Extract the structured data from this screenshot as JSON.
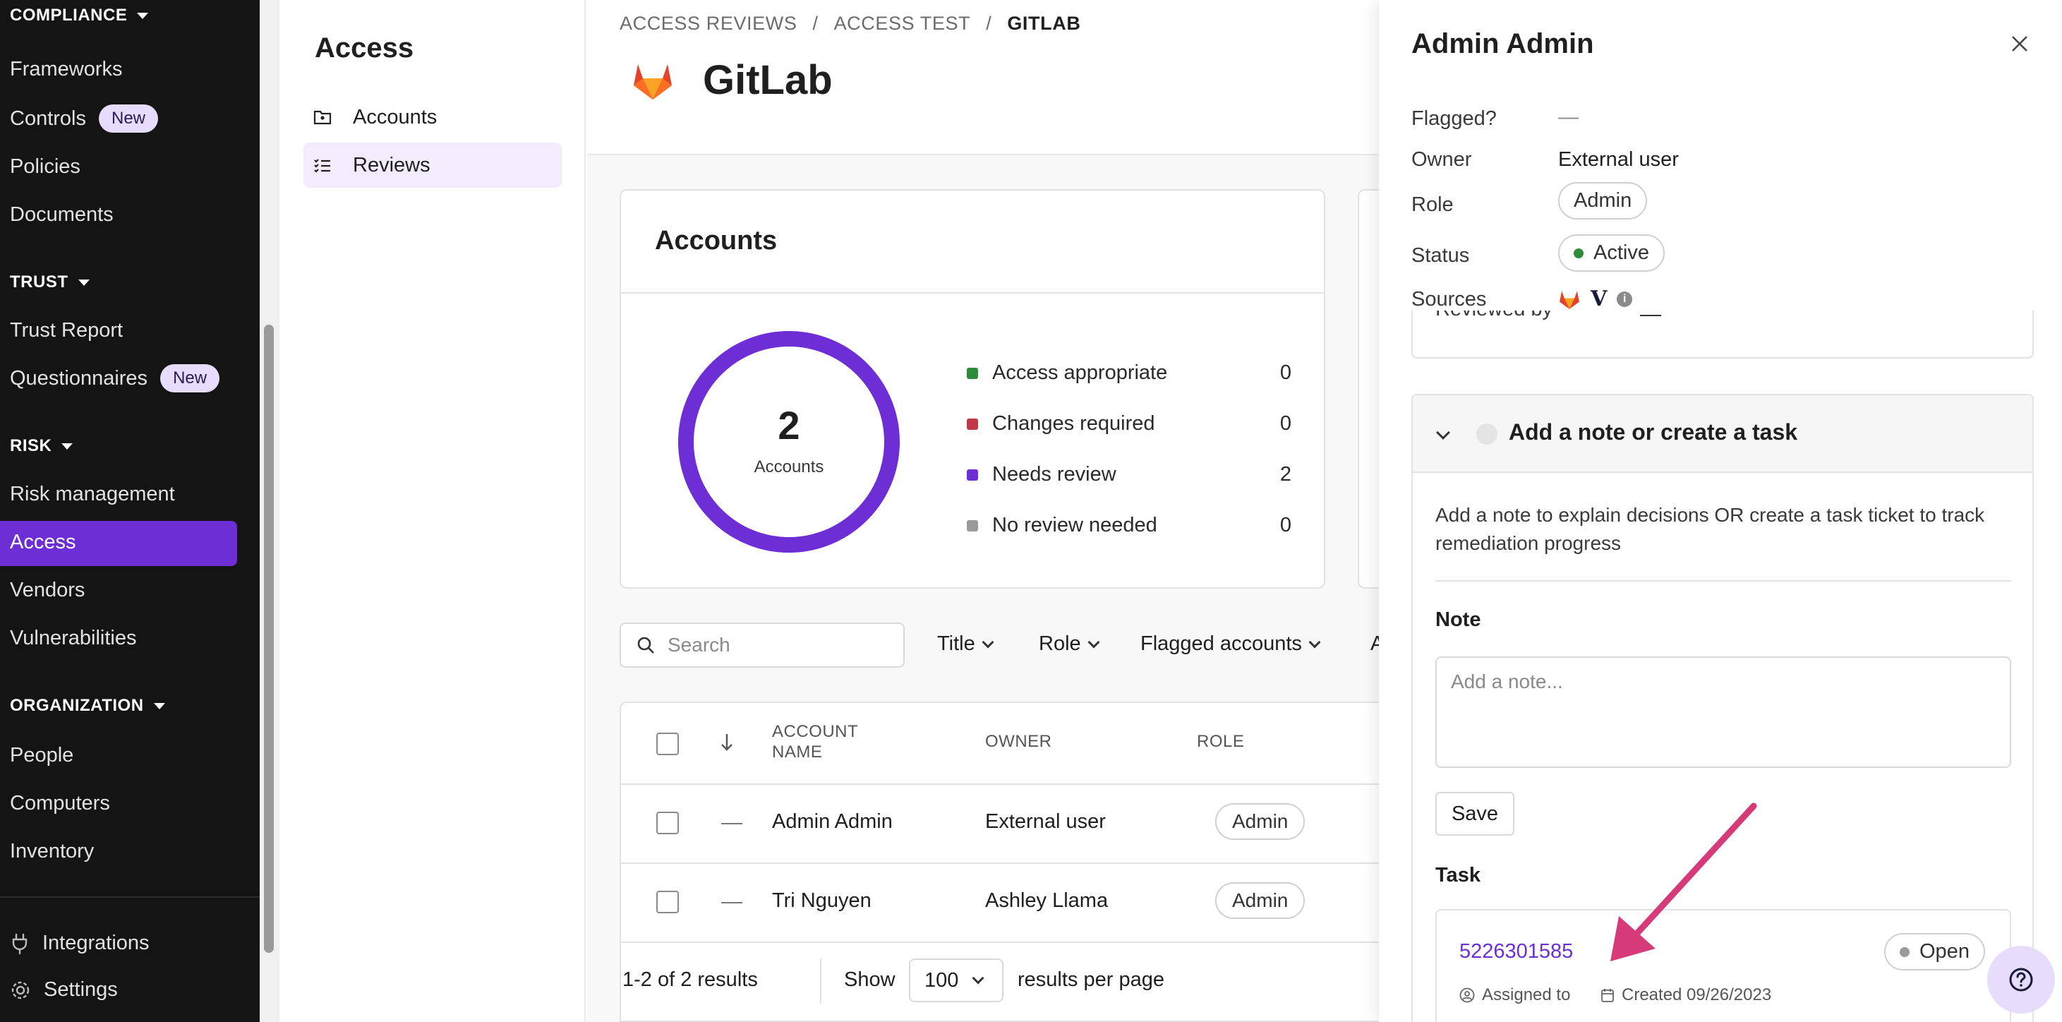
{
  "nav": {
    "compliance": {
      "label": "COMPLIANCE",
      "items": [
        "Frameworks",
        "Controls",
        "Policies",
        "Documents"
      ]
    },
    "trust": {
      "label": "TRUST",
      "items": [
        "Trust Report",
        "Questionnaires"
      ]
    },
    "risk": {
      "label": "RISK",
      "items": [
        "Risk management",
        "Access",
        "Vendors",
        "Vulnerabilities"
      ]
    },
    "organization": {
      "label": "ORGANIZATION",
      "items": [
        "People",
        "Computers",
        "Inventory"
      ]
    },
    "bottom": [
      "Integrations",
      "Settings"
    ],
    "new_badge": "New",
    "active": "Access"
  },
  "subnav": {
    "title": "Access",
    "items": [
      "Accounts",
      "Reviews"
    ],
    "active": "Reviews"
  },
  "breadcrumb": [
    "ACCESS REVIEWS",
    "ACCESS TEST",
    "GITLAB"
  ],
  "app": {
    "name": "GitLab",
    "logo": "gitlab-logo"
  },
  "accounts_card": {
    "title": "Accounts",
    "total": "2",
    "total_label": "Accounts",
    "legend": [
      {
        "label": "Access appropriate",
        "count": "0",
        "color": "#2f8a3a"
      },
      {
        "label": "Changes required",
        "count": "0",
        "color": "#c0394a"
      },
      {
        "label": "Needs review",
        "count": "2",
        "color": "#6d2ed6"
      },
      {
        "label": "No review needed",
        "count": "0",
        "color": "#9a9a9a"
      }
    ]
  },
  "filters": {
    "search_placeholder": "Search",
    "items": [
      "Title",
      "Role",
      "Flagged accounts"
    ],
    "partial": "A"
  },
  "table": {
    "headers": {
      "account_name": "ACCOUNT NAME",
      "owner": "OWNER",
      "role": "ROLE"
    },
    "rows": [
      {
        "flag": "—",
        "name": "Admin Admin",
        "owner": "External user",
        "role": "Admin"
      },
      {
        "flag": "—",
        "name": "Tri Nguyen",
        "owner": "Ashley Llama",
        "role": "Admin"
      }
    ],
    "pagination": {
      "results": "1-2 of 2 results",
      "show": "Show",
      "per_page": "100",
      "after": "results per page"
    }
  },
  "drawer": {
    "title": "Admin Admin",
    "fields": {
      "flagged_label": "Flagged?",
      "flagged_value": "—",
      "owner_label": "Owner",
      "owner_value": "External user",
      "role_label": "Role",
      "role_value": "Admin",
      "status_label": "Status",
      "status_value": "Active",
      "sources_label": "Sources",
      "sources_v": "V",
      "sources_info": "i"
    },
    "reviewed_by_label": "Reviewed by",
    "reviewed_by_value": "—",
    "note_panel": {
      "title": "Add a note or create a task",
      "description": "Add a note to explain decisions OR create a task ticket to track remediation progress",
      "note_label": "Note",
      "note_placeholder": "Add a note...",
      "save_label": "Save",
      "task_label": "Task",
      "task_id": "5226301585",
      "task_status": "Open",
      "assigned_to": "Assigned to",
      "created": "Created 09/26/2023"
    }
  },
  "colors": {
    "accent": "#6d2ed6",
    "nav_bg": "#141414",
    "annotation_arrow": "#d63a78"
  }
}
